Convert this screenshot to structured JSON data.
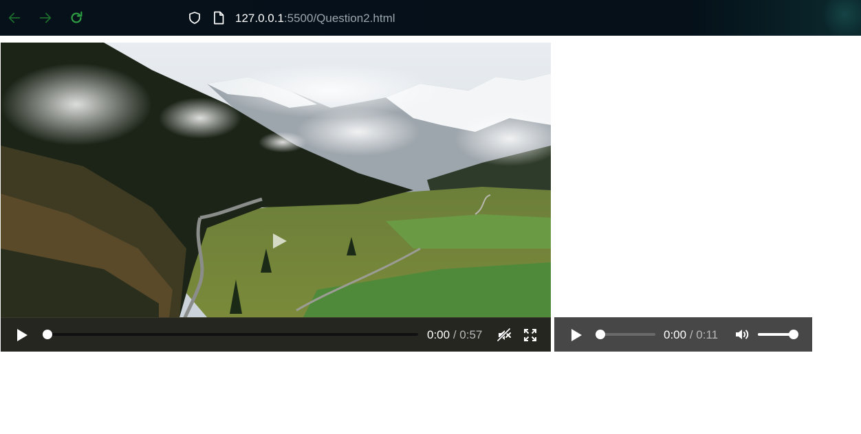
{
  "browser": {
    "url_host": "127.0.0.1",
    "url_rest": ":5500/Question2.html",
    "icons": {
      "back": "arrow-left-icon",
      "forward": "arrow-right-icon",
      "reload": "reload-icon",
      "security": "shield-icon",
      "page": "page-icon"
    },
    "accent_color": "#2ea043"
  },
  "video": {
    "current_time": "0:00",
    "separator": " / ",
    "duration": "0:57",
    "progress_fraction": 0.0,
    "muted": true,
    "icons": {
      "big_play": "play-icon",
      "play": "play-icon",
      "mute": "muted-speaker-icon",
      "fullscreen": "fullscreen-icon"
    }
  },
  "audio": {
    "current_time": "0:00",
    "separator": " / ",
    "duration": "0:11",
    "progress_fraction": 0.0,
    "volume_fraction": 1.0,
    "icons": {
      "play": "play-icon",
      "volume": "speaker-icon"
    }
  }
}
